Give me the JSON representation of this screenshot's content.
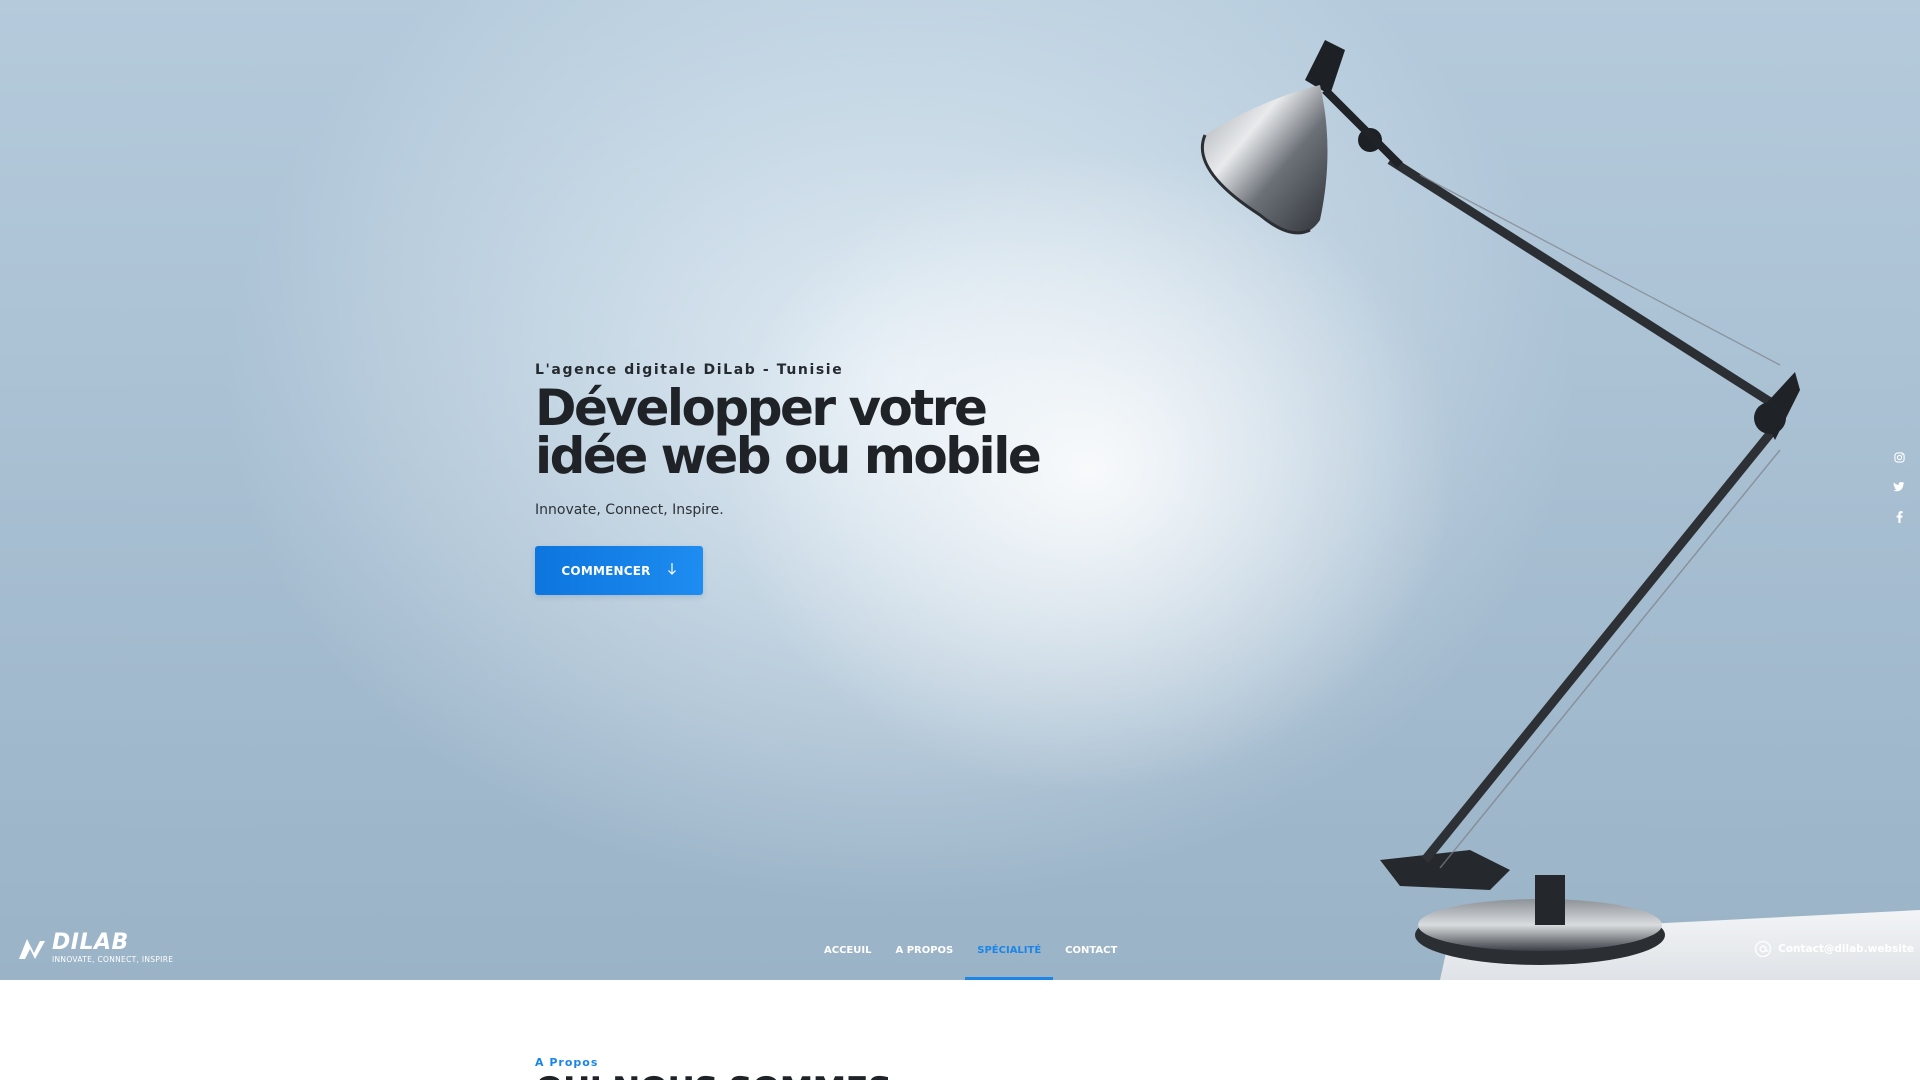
{
  "hero": {
    "eyebrow": "L'agence digitale DiLab - Tunisie",
    "title_line1": "Développer votre",
    "title_line2": "idée web ou mobile",
    "tagline": "Innovate, Connect, Inspire.",
    "cta_label": "COMMENCER",
    "cta_icon": "arrow-down-icon"
  },
  "brand": {
    "name": "DILAB",
    "slogan": "INNOVATE, CONNECT, INSPIRE"
  },
  "nav": {
    "items": [
      {
        "label": "ACCEUIL",
        "active": false
      },
      {
        "label": "A PROPOS",
        "active": false
      },
      {
        "label": "SPÉCIALITÉ",
        "active": true
      },
      {
        "label": "CONTACT",
        "active": false
      }
    ]
  },
  "contact": {
    "email": "Contact@dilab.website",
    "icon": "at-sign-icon"
  },
  "social": {
    "icons": [
      "instagram-icon",
      "twitter-icon",
      "facebook-icon"
    ]
  },
  "about": {
    "eyebrow": "A Propos",
    "title": "QUI NOUS SOMMES"
  },
  "colors": {
    "accent": "#1b86e8",
    "button": "#0c76de",
    "heading": "#1f2328",
    "hero_bg": "#a9c0d3"
  }
}
